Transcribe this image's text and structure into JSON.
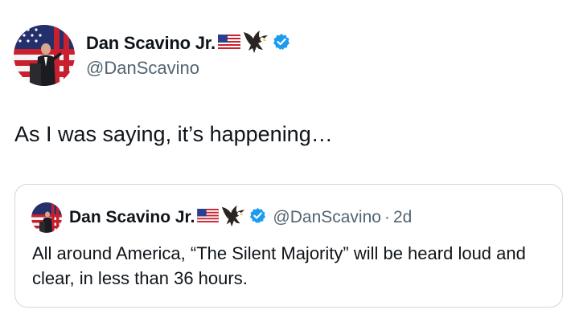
{
  "post": {
    "author": {
      "display_name": "Dan Scavino Jr.",
      "handle": "@DanScavino",
      "name_icons": [
        "us-flag-icon",
        "eagle-icon"
      ],
      "verified": true
    },
    "text": "As I was saying, it’s happening…",
    "quoted_post": {
      "author": {
        "display_name": "Dan Scavino Jr.",
        "handle": "@DanScavino",
        "name_icons": [
          "us-flag-icon",
          "eagle-icon"
        ],
        "verified": true
      },
      "separator": "·",
      "time": "2d",
      "text": "All around America, “The Silent Majority” will be heard loud and clear, in less than 36 hours."
    }
  },
  "colors": {
    "verified_blue": "#1d9bf0",
    "secondary_text": "#536471",
    "card_border": "#cfd9de"
  }
}
